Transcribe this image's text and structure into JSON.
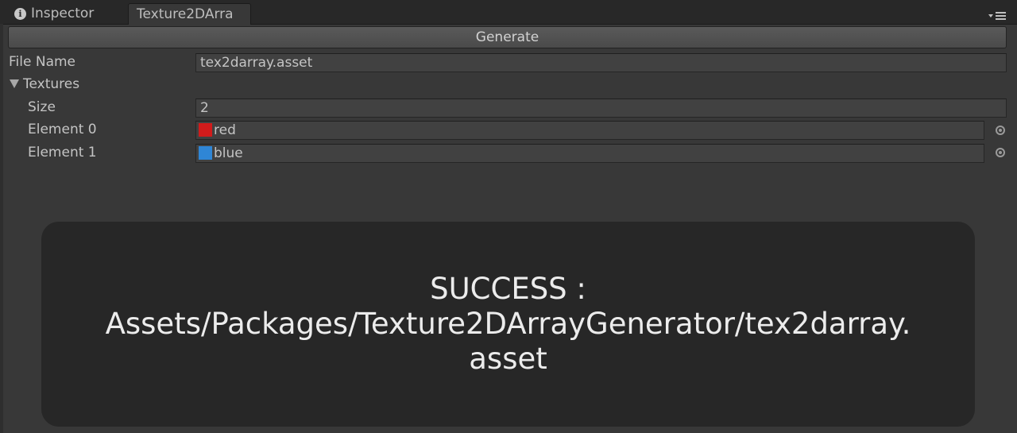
{
  "tabs": [
    {
      "label": "Inspector",
      "icon": "info-icon",
      "active": false
    },
    {
      "label": "Texture2DArra",
      "active": true
    }
  ],
  "tab_menu": {
    "icon": "tab-menu-icon"
  },
  "generate_button": {
    "label": "Generate"
  },
  "file_name": {
    "label": "File Name",
    "value": "tex2darray.asset"
  },
  "textures": {
    "label": "Textures",
    "expanded": true,
    "size": {
      "label": "Size",
      "value": "2"
    },
    "elements": [
      {
        "label": "Element 0",
        "value": "red",
        "icon_color": "#d11b1b"
      },
      {
        "label": "Element 1",
        "value": "blue",
        "icon_color": "#2f86d6"
      }
    ]
  },
  "notification": {
    "line1": "SUCCESS :",
    "line2": "Assets/Packages/Texture2DArrayGenerator/tex2darray.",
    "line3": "asset"
  }
}
